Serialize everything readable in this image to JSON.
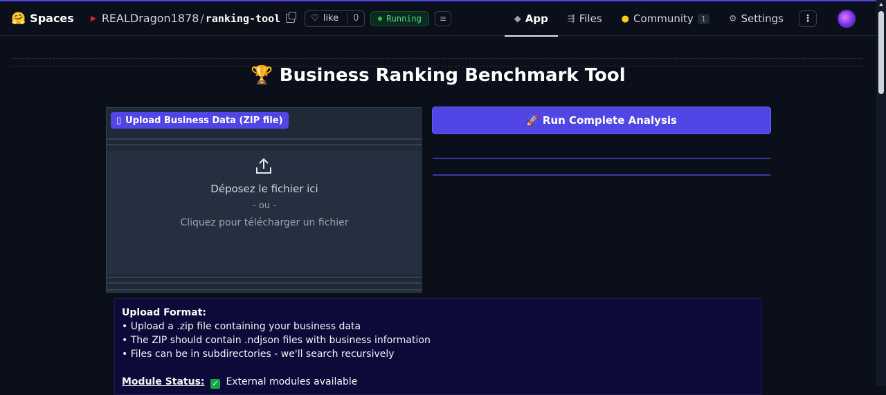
{
  "header": {
    "spaces_label": "Spaces",
    "owner": "REALDragon1878",
    "separator": "/",
    "repo": "ranking-tool",
    "like_label": "like",
    "like_count": "0",
    "status": "Running",
    "tabs": [
      {
        "label": "App",
        "icon": "cube-icon"
      },
      {
        "label": "Files",
        "icon": "files-icon"
      },
      {
        "label": "Community",
        "icon": "community-icon",
        "count": "1"
      },
      {
        "label": "Settings",
        "icon": "gear-icon"
      }
    ],
    "menu_symbol": "⋮"
  },
  "main": {
    "title": "🏆 Business Ranking Benchmark Tool",
    "upload_label": "Upload Business Data (ZIP file)",
    "drop_text": "Déposez le fichier ici",
    "drop_or": "- ou -",
    "drop_click": "Cliquez pour télécharger un fichier",
    "run_button": "🚀 Run Complete Analysis"
  },
  "info": {
    "title": "Upload Format:",
    "lines": [
      "• Upload a .zip file containing your business data",
      "• The ZIP should contain .ndjson files with business information",
      "• Files can be in subdirectories - we'll search recursively"
    ],
    "module_label": "Module Status:",
    "module_value": "External modules available"
  },
  "colors": {
    "accent": "#4f46e5",
    "background": "#0b0f19",
    "status_green": "#22c55e"
  }
}
